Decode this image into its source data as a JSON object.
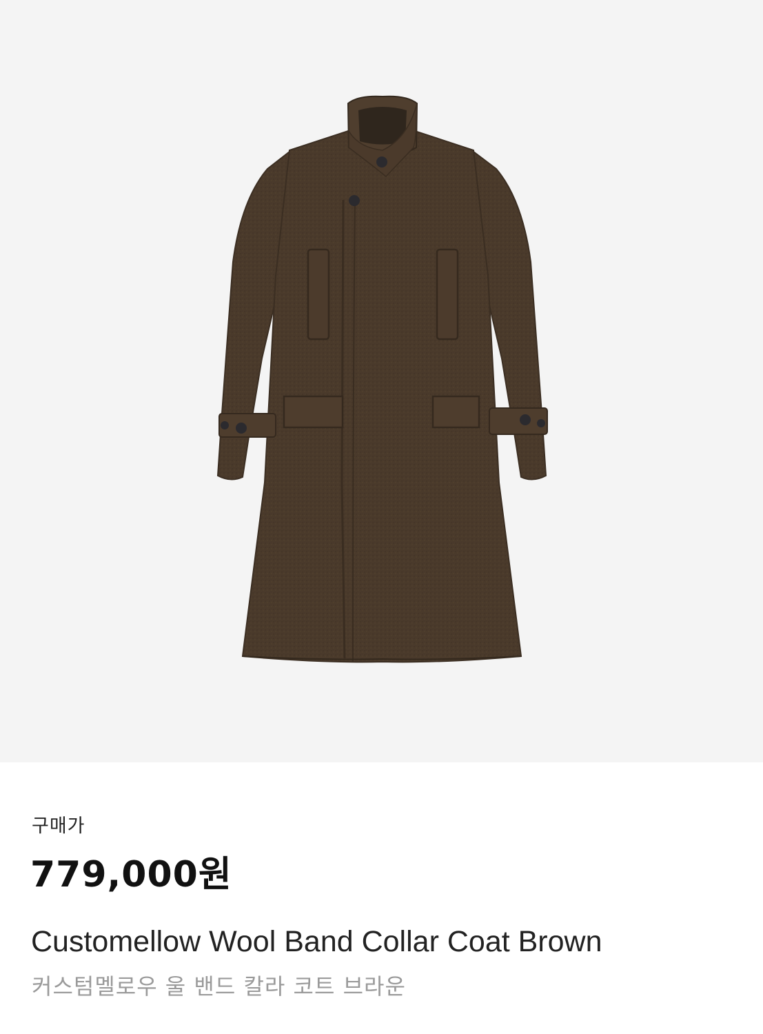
{
  "product": {
    "image_label": "coat-image",
    "price_label": "구매가",
    "price": "779,000원",
    "name_en": "Customellow Wool Band Collar Coat Brown",
    "name_ko": "커스텀멜로우 울 밴드 칼라 코트 브라운"
  },
  "colors": {
    "image_background": "#f4f4f4",
    "coat_main": "#4a3a2b",
    "coat_shadow": "#3b2e22",
    "coat_highlight": "#574533",
    "button": "#2b2a2e"
  }
}
